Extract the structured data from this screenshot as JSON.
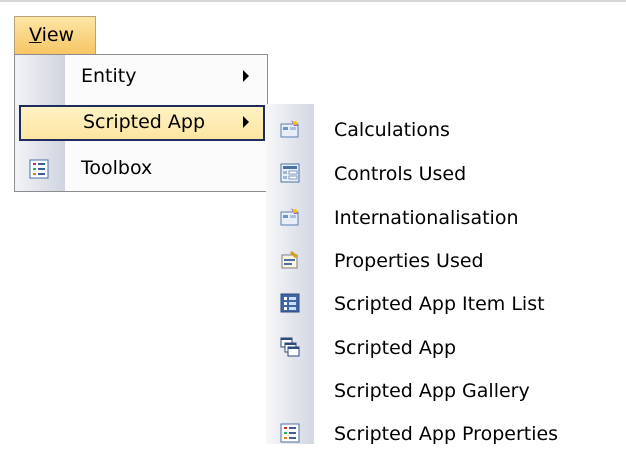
{
  "menubar": {
    "view_label": "View",
    "view_accel": "V",
    "view_rest": "iew"
  },
  "main_menu": {
    "items": [
      {
        "label": "Entity",
        "icon": "none",
        "has_submenu": true
      },
      {
        "label": "Scripted App",
        "icon": "none",
        "has_submenu": true,
        "highlighted": true
      },
      {
        "label": "Toolbox",
        "icon": "list-icon",
        "has_submenu": false
      }
    ]
  },
  "submenu": {
    "items": [
      {
        "label": "Calculations",
        "icon": "calculations-icon"
      },
      {
        "label": "Controls Used",
        "icon": "controls-icon"
      },
      {
        "label": "Internationalisation",
        "icon": "internationalisation-icon"
      },
      {
        "label": "Properties Used",
        "icon": "properties-icon"
      },
      {
        "label": "Scripted App Item List",
        "icon": "item-list-icon"
      },
      {
        "label": "Scripted App",
        "icon": "windows-icon"
      },
      {
        "label": "Scripted App Gallery",
        "icon": "none"
      },
      {
        "label": "Scripted App Properties",
        "icon": "list-icon"
      }
    ]
  },
  "colors": {
    "highlight_top": "#fff2c4",
    "highlight_bottom": "#fde5a2",
    "highlight_border": "#1f2a5e",
    "menu_header_top": "#fde6a6",
    "menu_header_bottom": "#f7c564"
  }
}
